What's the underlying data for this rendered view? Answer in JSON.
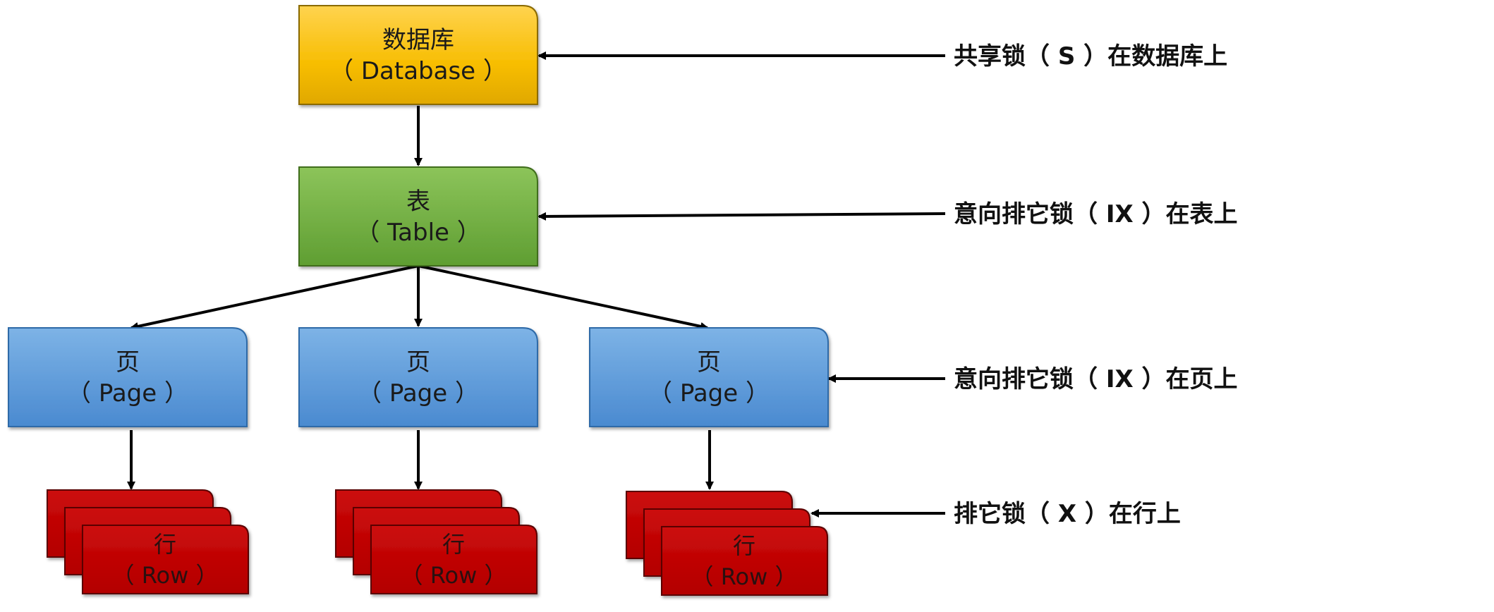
{
  "nodes": {
    "database": {
      "title": "数据库",
      "subtitle": "（ Database ）"
    },
    "table": {
      "title": "表",
      "subtitle": "（ Table ）"
    },
    "pages": [
      {
        "title": "页",
        "subtitle": "（ Page ）"
      },
      {
        "title": "页",
        "subtitle": "（ Page ）"
      },
      {
        "title": "页",
        "subtitle": "（ Page ）"
      }
    ],
    "rows": [
      {
        "title": "行",
        "subtitle": "（ Row ）"
      },
      {
        "title": "行",
        "subtitle": "（ Row ）"
      },
      {
        "title": "行",
        "subtitle": "（ Row ）"
      }
    ]
  },
  "annotations": {
    "database_lock": "共享锁（ S ）在数据库上",
    "table_lock": "意向排它锁（ IX ）在表上",
    "page_lock": "意向排它锁（ IX ）在页上",
    "row_lock": "排它锁（ X ）在行上"
  },
  "colors": {
    "database": "#f5b800",
    "table": "#6aab3c",
    "page": "#5b9bd5",
    "row": "#c00000",
    "arrow": "#000000"
  }
}
